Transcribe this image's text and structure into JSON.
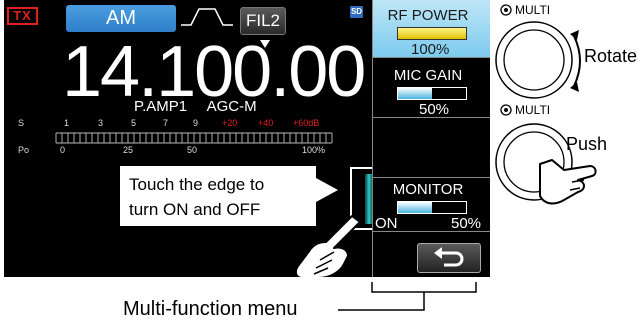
{
  "header": {
    "tx_label": "TX",
    "mode": "AM",
    "filter": "FIL2",
    "sd_badge": "SD"
  },
  "frequency": "14.100.00",
  "status": {
    "preamp": "P.AMP1",
    "agc": "AGC-M"
  },
  "meter": {
    "s_label": "S",
    "s_ticks": [
      "1",
      "3",
      "5",
      "7",
      "9",
      "+20",
      "+40",
      "+60dB"
    ],
    "po_label": "Po",
    "po_ticks": [
      "0",
      "25",
      "50",
      "100%"
    ],
    "red_color": "#e0201c"
  },
  "callout": {
    "line1": "Touch the edge to",
    "line2": "turn ON and OFF"
  },
  "multi_menu": {
    "items": [
      {
        "label": "RF POWER",
        "value": "100%",
        "level": 100,
        "active": true
      },
      {
        "label": "MIC GAIN",
        "value": "50%",
        "level": 50,
        "active": false
      },
      {
        "label": "",
        "value": "",
        "level": null,
        "active": false
      },
      {
        "label": "MONITOR",
        "status": "ON",
        "value": "50%",
        "level": 50,
        "active": false
      }
    ],
    "back_icon": "return-arrow-icon"
  },
  "dial_rotate": {
    "label": "MULTI",
    "action": "Rotate"
  },
  "dial_push": {
    "label": "MULTI",
    "action": "Push"
  },
  "caption": "Multi-function menu",
  "colors": {
    "mode_button": "#2f7fc8",
    "active_item": "#7ccbee",
    "level_yellow": "#e0c000",
    "level_blue": "#4ab2e0",
    "edge_bar": "#28d0c8"
  }
}
